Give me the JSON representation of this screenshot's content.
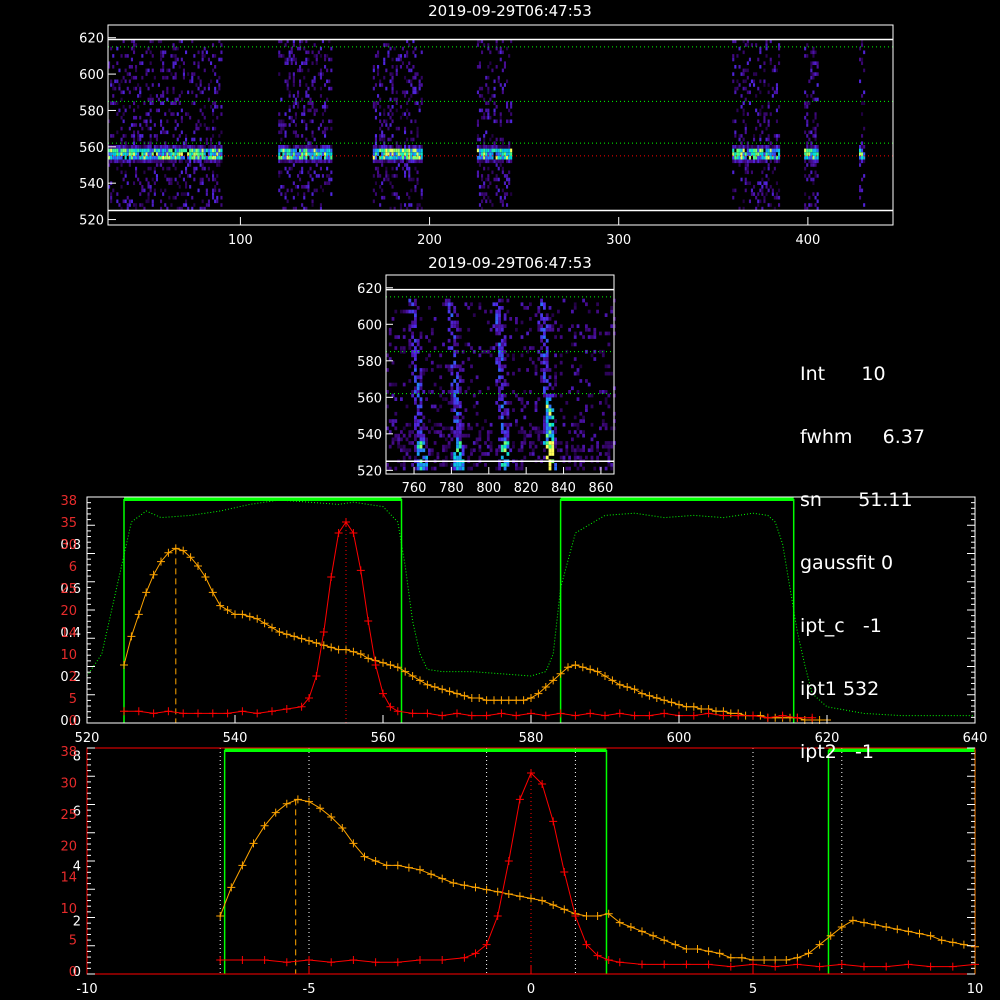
{
  "panel1": {
    "title": "2019-09-29T06:47:53",
    "x_ticks": [
      "100",
      "200",
      "300",
      "400"
    ],
    "x_tick_values": [
      100,
      200,
      300,
      400
    ],
    "xlim": [
      30,
      445
    ],
    "y_ticks": [
      "520",
      "540",
      "560",
      "580",
      "600",
      "620"
    ],
    "y_tick_values": [
      520,
      540,
      560,
      580,
      600,
      620
    ],
    "ylim": [
      517,
      627
    ],
    "white_lines_y": [
      525,
      619
    ],
    "green_dotted_y": [
      562,
      585,
      615
    ],
    "red_dotted_y": [
      555
    ],
    "bands": [
      [
        30,
        90
      ],
      [
        120,
        148
      ],
      [
        170,
        196
      ],
      [
        225,
        243
      ],
      [
        360,
        385
      ],
      [
        398,
        405
      ],
      [
        427,
        430
      ]
    ],
    "bright_level": 555,
    "colors": {
      "white_line": "#ffffff",
      "green_dotted": "#00ff00",
      "red_dotted": "#ff0000"
    }
  },
  "panel2": {
    "title": "2019-09-29T06:47:53",
    "x_ticks": [
      "760",
      "780",
      "800",
      "820",
      "840",
      "860"
    ],
    "x_tick_values": [
      760,
      780,
      800,
      820,
      840,
      860
    ],
    "xlim": [
      745,
      867
    ],
    "y_ticks": [
      "520",
      "540",
      "560",
      "580",
      "600",
      "620"
    ],
    "y_tick_values": [
      520,
      540,
      560,
      580,
      600,
      620
    ],
    "ylim": [
      518,
      627
    ],
    "white_lines_y": [
      525,
      619
    ],
    "green_dotted_y": [
      562,
      585,
      615
    ],
    "streak_x": [
      763,
      783,
      808,
      832
    ],
    "strong_streak_x": 832
  },
  "info": {
    "lines": [
      {
        "label": "Int",
        "value": "10"
      },
      {
        "label": "fwhm",
        "value": "6.37"
      },
      {
        "label": "sn",
        "value": "51.11"
      },
      {
        "label": "gaussfit",
        "value": "0"
      },
      {
        "label": "ipt_c",
        "value": "-1"
      },
      {
        "label": "ipt1",
        "value": "532"
      },
      {
        "label": "ipt2",
        "value": "-1"
      }
    ]
  },
  "chart_data": [
    {
      "type": "line",
      "x_ticks": [
        "520",
        "540",
        "560",
        "580",
        "600",
        "620",
        "640"
      ],
      "x_tick_values": [
        520,
        540,
        560,
        580,
        600,
        620,
        640
      ],
      "xlim": [
        520,
        640
      ],
      "y_left_white_ticks": [
        "0.0",
        "0.2",
        "0.4",
        "0.6",
        "0.8"
      ],
      "y_left_white_values": [
        0,
        0.2,
        0.4,
        0.6,
        0.8
      ],
      "y_left_red_ticks": [
        "0",
        "5",
        "2",
        "10",
        "14",
        "20",
        "25",
        "6",
        "30",
        "35",
        "38"
      ],
      "ylim": [
        0,
        1
      ],
      "green_boxes": [
        [
          525,
          562.5
        ],
        [
          584,
          615.5
        ]
      ],
      "vlines_dashed_orange": [
        532
      ],
      "vlines_dotted_red": [
        555
      ],
      "series": [
        {
          "name": "",
          "color": "#ffa500",
          "marker": "plus",
          "x": [
            525,
            526,
            527,
            528,
            529,
            530,
            531,
            532,
            533,
            534,
            535,
            536,
            537,
            538,
            539,
            540,
            541,
            542,
            543,
            544,
            545,
            546,
            547,
            548,
            549,
            550,
            551,
            552,
            553,
            554,
            555,
            556,
            557,
            558,
            559,
            560,
            561,
            562,
            563,
            564,
            565,
            566,
            567,
            568,
            569,
            570,
            571,
            572,
            573,
            574,
            575,
            576,
            577,
            578,
            579,
            580,
            581,
            582,
            583,
            584,
            585,
            586,
            587,
            588,
            589,
            590,
            591,
            592,
            593,
            594,
            595,
            596,
            597,
            598,
            599,
            600,
            601,
            602,
            603,
            604,
            605,
            606,
            607,
            608,
            609,
            610,
            611,
            612,
            613,
            614,
            615,
            616,
            617,
            618,
            619,
            620
          ],
          "y": [
            0.25,
            0.38,
            0.48,
            0.58,
            0.66,
            0.72,
            0.76,
            0.78,
            0.77,
            0.74,
            0.7,
            0.65,
            0.58,
            0.52,
            0.5,
            0.48,
            0.48,
            0.47,
            0.46,
            0.44,
            0.42,
            0.4,
            0.39,
            0.38,
            0.37,
            0.36,
            0.35,
            0.34,
            0.33,
            0.32,
            0.32,
            0.31,
            0.3,
            0.28,
            0.27,
            0.26,
            0.25,
            0.24,
            0.22,
            0.2,
            0.18,
            0.16,
            0.15,
            0.14,
            0.13,
            0.12,
            0.11,
            0.1,
            0.1,
            0.09,
            0.09,
            0.09,
            0.09,
            0.09,
            0.09,
            0.1,
            0.12,
            0.15,
            0.18,
            0.21,
            0.24,
            0.25,
            0.24,
            0.23,
            0.22,
            0.2,
            0.18,
            0.16,
            0.15,
            0.14,
            0.12,
            0.11,
            0.1,
            0.09,
            0.08,
            0.07,
            0.06,
            0.06,
            0.05,
            0.05,
            0.04,
            0.04,
            0.03,
            0.03,
            0.02,
            0.02,
            0.02,
            0.01,
            0.01,
            0.01,
            0.01,
            0.01,
            0.0,
            0.0,
            0.0,
            0.0
          ]
        },
        {
          "name": "",
          "color": "#ff0000",
          "marker": "plus",
          "x": [
            525,
            527,
            529,
            531,
            533,
            535,
            537,
            539,
            541,
            543,
            545,
            547,
            549,
            550,
            551,
            552,
            553,
            554,
            555,
            556,
            557,
            558,
            559,
            560,
            561,
            562,
            564,
            566,
            568,
            570,
            572,
            574,
            576,
            578,
            580,
            582,
            584,
            586,
            588,
            590,
            592,
            594,
            596,
            598,
            600,
            602,
            604,
            606,
            608,
            610,
            612,
            614,
            616,
            618
          ],
          "y": [
            0.04,
            0.04,
            0.03,
            0.04,
            0.03,
            0.03,
            0.03,
            0.03,
            0.04,
            0.03,
            0.04,
            0.05,
            0.06,
            0.1,
            0.2,
            0.4,
            0.65,
            0.85,
            0.9,
            0.85,
            0.68,
            0.45,
            0.25,
            0.12,
            0.06,
            0.04,
            0.03,
            0.03,
            0.02,
            0.03,
            0.02,
            0.02,
            0.03,
            0.02,
            0.03,
            0.02,
            0.03,
            0.02,
            0.03,
            0.02,
            0.03,
            0.02,
            0.02,
            0.03,
            0.02,
            0.02,
            0.03,
            0.02,
            0.02,
            0.02,
            0.01,
            0.02,
            0.01,
            0.01
          ]
        },
        {
          "name": "",
          "color": "#00ff00",
          "marker": "dotted",
          "x": [
            520,
            522,
            524,
            526,
            528,
            530,
            534,
            538,
            542,
            546,
            550,
            554,
            556,
            558,
            560,
            562,
            563,
            564,
            565,
            566,
            568,
            572,
            576,
            580,
            582,
            583,
            584,
            586,
            590,
            594,
            598,
            602,
            606,
            610,
            612,
            613,
            614,
            615,
            616,
            617,
            618,
            620,
            625,
            630,
            640
          ],
          "y": [
            0.2,
            0.3,
            0.6,
            0.9,
            0.95,
            0.92,
            0.93,
            0.95,
            0.98,
            1.0,
            0.99,
            0.98,
            0.99,
            0.98,
            0.97,
            0.9,
            0.7,
            0.45,
            0.3,
            0.23,
            0.22,
            0.22,
            0.21,
            0.2,
            0.22,
            0.3,
            0.6,
            0.85,
            0.93,
            0.94,
            0.92,
            0.93,
            0.92,
            0.94,
            0.93,
            0.9,
            0.8,
            0.6,
            0.4,
            0.25,
            0.12,
            0.06,
            0.03,
            0.02,
            0.02
          ]
        }
      ]
    },
    {
      "type": "line",
      "x_ticks": [
        "-10",
        "-5",
        "0",
        "5",
        "10"
      ],
      "x_tick_values": [
        -10,
        -5,
        0,
        5,
        10
      ],
      "xlim": [
        -10,
        10
      ],
      "y_left_white_ticks": [
        "0",
        "2",
        "4",
        "6",
        "8"
      ],
      "y_left_red_ticks": [
        "0",
        "5",
        "10",
        "14",
        "20",
        "25",
        "30",
        "38"
      ],
      "ylim": [
        0,
        1
      ],
      "green_boxes": [
        [
          -6.9,
          1.7
        ],
        [
          6.7,
          10
        ]
      ],
      "vlines_dashed_orange": [
        -5.3
      ],
      "vlines_dotted_red": [
        0
      ],
      "vlines_dotted_white": [
        -7.0,
        -5.0,
        -1.0,
        1.0,
        5.0,
        7.0
      ],
      "series": [
        {
          "name": "",
          "color": "#ffa500",
          "marker": "plus",
          "x": [
            -7.0,
            -6.75,
            -6.5,
            -6.25,
            -6.0,
            -5.75,
            -5.5,
            -5.25,
            -5.0,
            -4.75,
            -4.5,
            -4.25,
            -4.0,
            -3.75,
            -3.5,
            -3.25,
            -3.0,
            -2.75,
            -2.5,
            -2.25,
            -2.0,
            -1.75,
            -1.5,
            -1.25,
            -1.0,
            -0.75,
            -0.5,
            -0.25,
            0.0,
            0.25,
            0.5,
            0.75,
            1.0,
            1.25,
            1.5,
            1.75,
            2.0,
            2.25,
            2.5,
            2.75,
            3.0,
            3.25,
            3.5,
            3.75,
            4.0,
            4.25,
            4.5,
            4.75,
            5.0,
            5.25,
            5.5,
            5.75,
            6.0,
            6.25,
            6.5,
            6.75,
            7.0,
            7.25,
            7.5,
            7.75,
            8.0,
            8.25,
            8.5,
            8.75,
            9.0,
            9.25,
            9.5,
            9.75,
            10.0
          ],
          "y": [
            0.25,
            0.38,
            0.48,
            0.58,
            0.66,
            0.72,
            0.76,
            0.78,
            0.77,
            0.74,
            0.7,
            0.65,
            0.58,
            0.52,
            0.5,
            0.48,
            0.48,
            0.47,
            0.46,
            0.44,
            0.42,
            0.4,
            0.39,
            0.38,
            0.37,
            0.36,
            0.35,
            0.34,
            0.33,
            0.32,
            0.3,
            0.28,
            0.26,
            0.25,
            0.25,
            0.26,
            0.22,
            0.2,
            0.18,
            0.16,
            0.14,
            0.12,
            0.1,
            0.1,
            0.09,
            0.08,
            0.06,
            0.06,
            0.05,
            0.05,
            0.05,
            0.05,
            0.06,
            0.08,
            0.12,
            0.16,
            0.2,
            0.23,
            0.22,
            0.21,
            0.2,
            0.19,
            0.18,
            0.17,
            0.16,
            0.14,
            0.13,
            0.12,
            0.11
          ]
        },
        {
          "name": "",
          "color": "#ff0000",
          "marker": "plus",
          "x": [
            -7.0,
            -6.5,
            -6.0,
            -5.5,
            -5.0,
            -4.5,
            -4.0,
            -3.5,
            -3.0,
            -2.5,
            -2.0,
            -1.5,
            -1.25,
            -1.0,
            -0.75,
            -0.5,
            -0.25,
            0.0,
            0.25,
            0.5,
            0.75,
            1.0,
            1.25,
            1.5,
            1.75,
            2.0,
            2.5,
            3.0,
            3.5,
            4.0,
            4.5,
            5.0,
            5.5,
            6.0,
            6.5,
            7.0,
            7.5,
            8.0,
            8.5,
            9.0,
            9.5,
            10.0
          ],
          "y": [
            0.05,
            0.05,
            0.05,
            0.04,
            0.05,
            0.04,
            0.05,
            0.04,
            0.04,
            0.05,
            0.05,
            0.06,
            0.08,
            0.12,
            0.25,
            0.5,
            0.78,
            0.9,
            0.85,
            0.68,
            0.45,
            0.25,
            0.12,
            0.07,
            0.05,
            0.04,
            0.03,
            0.03,
            0.03,
            0.03,
            0.02,
            0.03,
            0.02,
            0.03,
            0.02,
            0.03,
            0.02,
            0.02,
            0.03,
            0.02,
            0.02,
            0.03
          ]
        }
      ]
    }
  ]
}
